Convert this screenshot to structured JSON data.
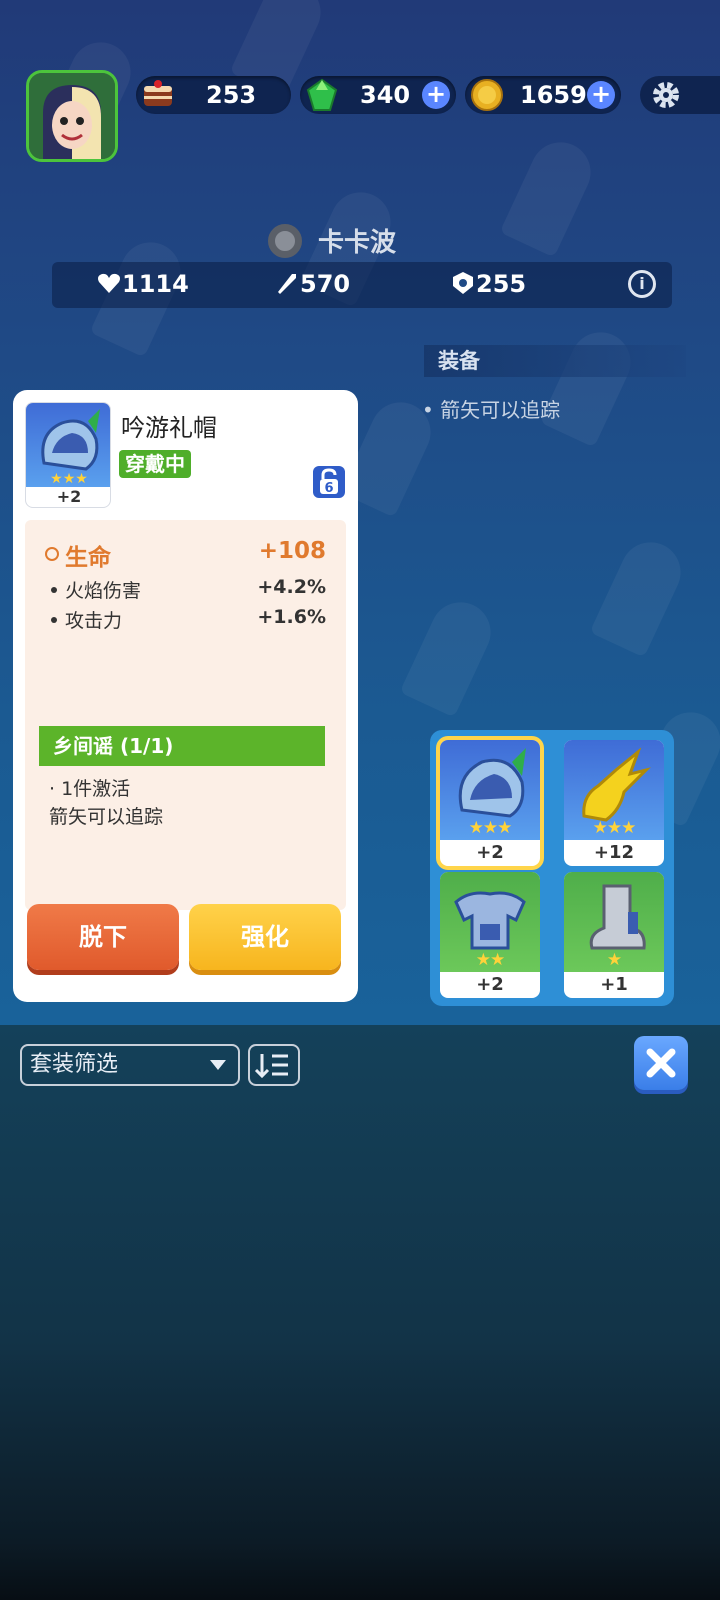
{
  "currency": {
    "cake": "253",
    "gems": "340",
    "coins": "1659"
  },
  "character": {
    "name": "卡卡波",
    "hp": "1114",
    "attack": "570",
    "defense": "255"
  },
  "equip_section": {
    "title": "装备",
    "note": "• 箭矢可以追踪"
  },
  "item": {
    "name": "吟游礼帽",
    "status": "穿戴中",
    "level": "+2",
    "lock_number": "6",
    "main_attr": {
      "label": "生命",
      "value": "+108"
    },
    "sub_attrs": [
      {
        "label": "火焰伤害",
        "value": "+4.2%"
      },
      {
        "label": "攻击力",
        "value": "+1.6%"
      }
    ],
    "set": {
      "name": "乡间谣 (1/1)",
      "line1": "· 1件激活",
      "line2": "箭矢可以追踪"
    },
    "buttons": {
      "remove": "脱下",
      "upgrade": "强化"
    }
  },
  "slots": [
    {
      "level": "+2",
      "stars": 3,
      "icon": "hat-icon",
      "color": "#4a7fe0"
    },
    {
      "level": "+12",
      "stars": 3,
      "icon": "glove-icon",
      "color": "#4a7fe0"
    },
    {
      "level": "+2",
      "stars": 2,
      "icon": "armor-icon",
      "color": "#4fae4a"
    },
    {
      "level": "+1",
      "stars": 1,
      "icon": "boot-icon",
      "color": "#4fae4a"
    }
  ],
  "filter": {
    "label": "套装筛选"
  },
  "colors": {
    "accent_orange": "#e07a2e",
    "worn_green": "#4fae2a",
    "set_green": "#5cb42a"
  }
}
